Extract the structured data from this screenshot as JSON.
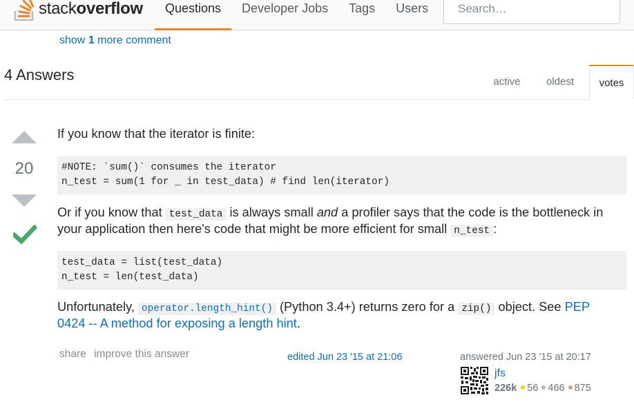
{
  "header": {
    "logo_text_light": "stack",
    "logo_text_bold": "overflow",
    "nav": [
      "Questions",
      "Developer Jobs",
      "Tags",
      "Users"
    ],
    "active_nav": "Questions",
    "search_placeholder": "Search…",
    "accent_color": "#f48024"
  },
  "comments": {
    "show_prefix": "show",
    "count": "1",
    "show_suffix": "more comment"
  },
  "answers": {
    "count_title": "4 Answers",
    "sort_tabs": [
      "active",
      "oldest",
      "votes"
    ],
    "active_sort": "votes"
  },
  "answer": {
    "votes": "20",
    "accepted": true,
    "p1": "If you know that the iterator is finite:",
    "code1": [
      "#NOTE: `sum()` consumes the iterator",
      "n_test = sum(1 for _ in test_data) # find len(iterator)"
    ],
    "p2_a": "Or if you know that ",
    "p2_code1": "test_data",
    "p2_b": " is always small ",
    "p2_em": "and",
    "p2_c": " a profiler says that the code is the bottleneck in",
    "p2_d": "your application then here's code that might be more efficient for small ",
    "p2_code2": "n_test",
    "p2_e": ":",
    "code2": [
      "test_data = list(test_data)",
      "n_test = len(test_data)"
    ],
    "p3_a": "Unfortunately, ",
    "p3_code1": "operator.length_hint()",
    "p3_b": " (Python 3.4+) returns zero for a ",
    "p3_code2": "zip()",
    "p3_c": " object. See ",
    "p3_link1": "PEP",
    "p3_link2": "0424 -- A method for exposing a length hint",
    "p3_d": "."
  },
  "post_menu": {
    "share": "share",
    "improve": "improve this answer"
  },
  "edited": {
    "text": "edited Jun 23 '15 at 21:06"
  },
  "answered": {
    "text": "answered Jun 23 '15 at 20:17",
    "user": "jfs",
    "reputation": "226k",
    "gold": "56",
    "silver": "466",
    "bronze": "875",
    "gold_color": "#ffcc01",
    "silver_color": "#b4b8bc",
    "bronze_color": "#d1a684"
  }
}
